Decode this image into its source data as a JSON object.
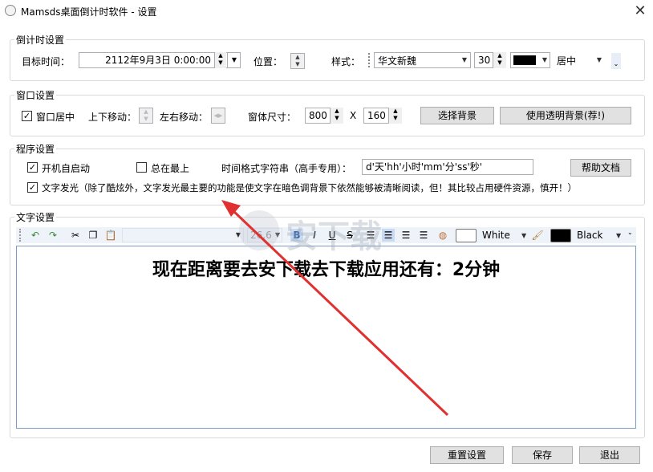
{
  "window": {
    "title": "Mamsds桌面倒计时软件 - 设置",
    "close": "✕"
  },
  "countdown": {
    "group": "倒计时设置",
    "target_label": "目标时间：",
    "target_value": "2112年9月3日 0:00:00",
    "position_label": "位置：",
    "style_label": "样式：",
    "font": "华文新魏",
    "size": "30",
    "color": "#000000",
    "align": "居中"
  },
  "window_settings": {
    "group": "窗口设置",
    "center_label": "窗口居中",
    "center_checked": true,
    "updown_label": "上下移动：",
    "leftright_label": "左右移动：",
    "size_label": "窗体尺寸：",
    "width": "800",
    "x": "X",
    "height": "160",
    "choose_bg": "选择背景",
    "transparent_bg": "使用透明背景(荐!)"
  },
  "program": {
    "group": "程序设置",
    "autostart_label": "开机自启动",
    "autostart_checked": true,
    "topmost_label": "总在最上",
    "topmost_checked": false,
    "format_label": "时间格式字符串（高手专用）：",
    "format_value": "d'天'hh'小时'mm'分'ss'秒'",
    "help": "帮助文档",
    "glow_label": "文字发光（除了酷炫外，文字发光最主要的功能是使文字在暗色调背景下依然能够被清晰阅读，但！其比较占用硬件资源，慎开！）",
    "glow_checked": true
  },
  "text_settings": {
    "group": "文字设置",
    "font_size": "26.6",
    "bg_label": "White",
    "bg_color": "#ffffff",
    "fg_label": "Black",
    "fg_color": "#000000",
    "content": "现在距离要去安下载去下载应用还有：2分钟"
  },
  "footer": {
    "reset": "重置设置",
    "save": "保存",
    "exit": "退出"
  },
  "watermark": "安下载"
}
